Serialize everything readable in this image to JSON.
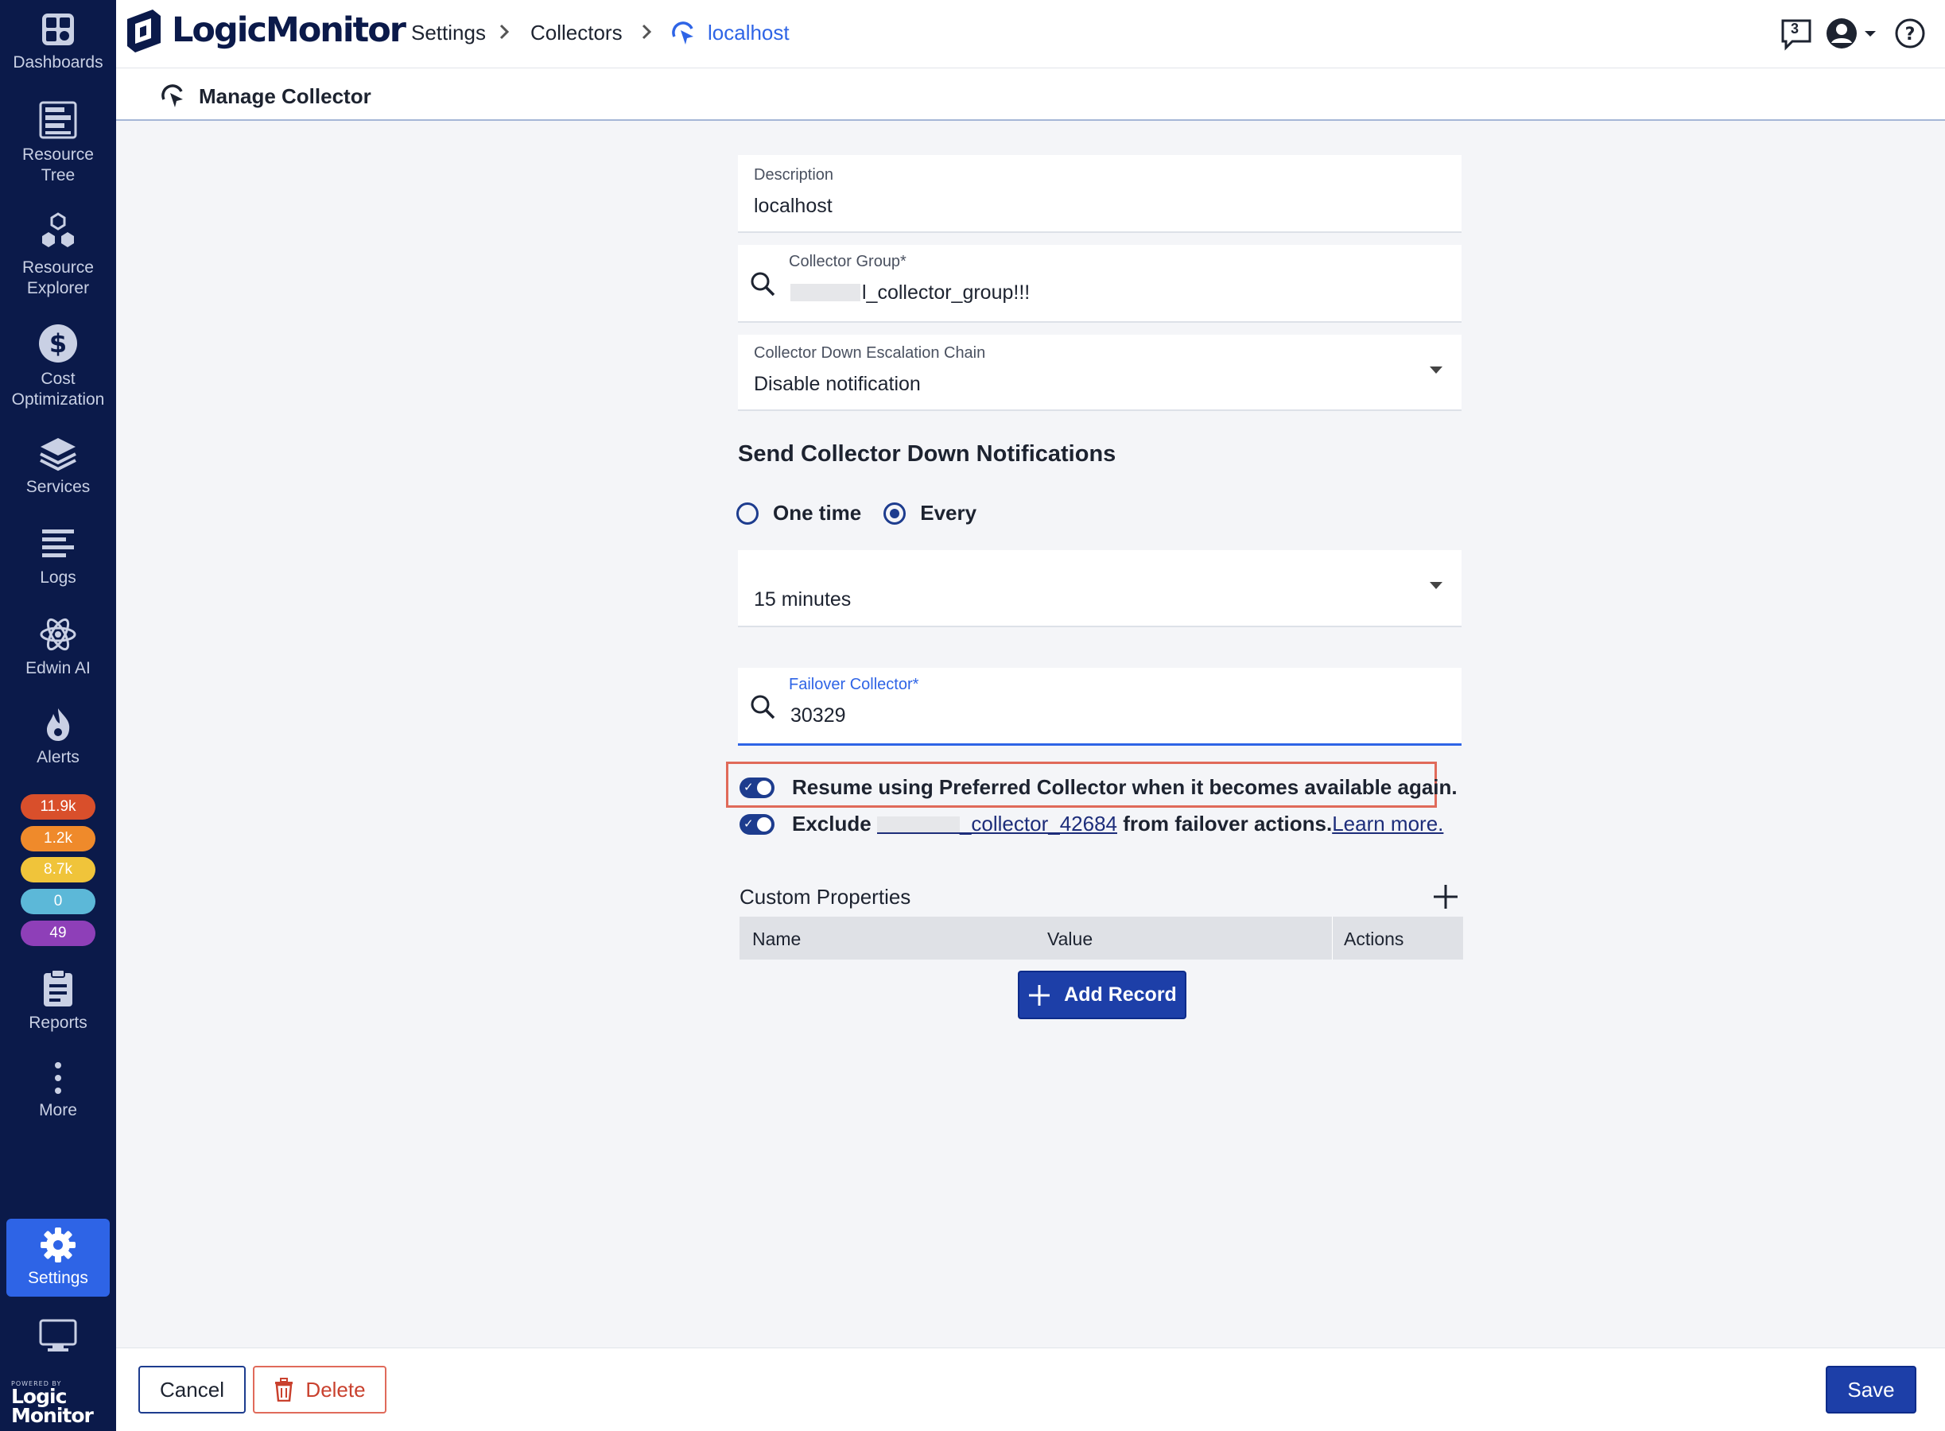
{
  "app": {
    "brand": "LogicMonitor",
    "powered_by": "POWERED BY",
    "powered_logo_1": "Logic",
    "powered_logo_2": "Monitor"
  },
  "sidebar": {
    "items": [
      {
        "label": "Dashboards",
        "icon": "dashboards-icon"
      },
      {
        "label_1": "Resource",
        "label_2": "Tree",
        "icon": "resource-tree-icon"
      },
      {
        "label_1": "Resource",
        "label_2": "Explorer",
        "icon": "resource-explorer-icon"
      },
      {
        "label_1": "Cost",
        "label_2": "Optimization",
        "icon": "dollar-icon"
      },
      {
        "label": "Services",
        "icon": "layers-icon"
      },
      {
        "label": "Logs",
        "icon": "logs-icon"
      },
      {
        "label": "Edwin AI",
        "icon": "atom-icon"
      },
      {
        "label": "Alerts",
        "icon": "flame-icon"
      },
      {
        "label": "Reports",
        "icon": "clipboard-icon"
      },
      {
        "label": "More",
        "icon": "more-vertical-icon"
      },
      {
        "label": "Settings",
        "icon": "gear-icon"
      }
    ],
    "alert_badges": [
      {
        "value": "11.9k",
        "color": "#d94f2b"
      },
      {
        "value": "1.2k",
        "color": "#ef8a2b"
      },
      {
        "value": "8.7k",
        "color": "#f0c43a"
      },
      {
        "value": "0",
        "color": "#5cb8d8"
      },
      {
        "value": "49",
        "color": "#8e3fb8"
      }
    ]
  },
  "header": {
    "breadcrumb": [
      "Settings",
      "Collectors",
      "localhost"
    ],
    "notifications_count": "3"
  },
  "subheader": {
    "title": "Manage Collector"
  },
  "form": {
    "description": {
      "label": "Description",
      "value": "localhost"
    },
    "collector_group": {
      "label": "Collector Group*",
      "value": "l_collector_group!!!"
    },
    "escalation_chain": {
      "label": "Collector Down Escalation Chain",
      "value": "Disable notification"
    },
    "notifications_title": "Send Collector Down Notifications",
    "radio_options": [
      "One time",
      "Every"
    ],
    "radio_selected": "Every",
    "interval": {
      "value": "15 minutes"
    },
    "failover": {
      "label": "Failover Collector*",
      "value": "30329"
    },
    "resume_toggle": {
      "label": "Resume using Preferred Collector when it becomes available again.",
      "on": true
    },
    "exclude_toggle": {
      "prefix": "Exclude",
      "collector": "_collector_42684",
      "suffix": "from failover actions.",
      "link": "Learn more.",
      "on": true
    }
  },
  "custom_properties": {
    "title": "Custom Properties",
    "columns": [
      "Name",
      "Value",
      "Actions"
    ],
    "add_record_label": "Add Record"
  },
  "footer": {
    "cancel_label": "Cancel",
    "delete_label": "Delete",
    "save_label": "Save"
  },
  "colors": {
    "sidebar_bg": "#0b1a4a",
    "accent": "#2e64e6",
    "primary_button": "#1d3fa8",
    "highlight": "#e06a5a"
  }
}
